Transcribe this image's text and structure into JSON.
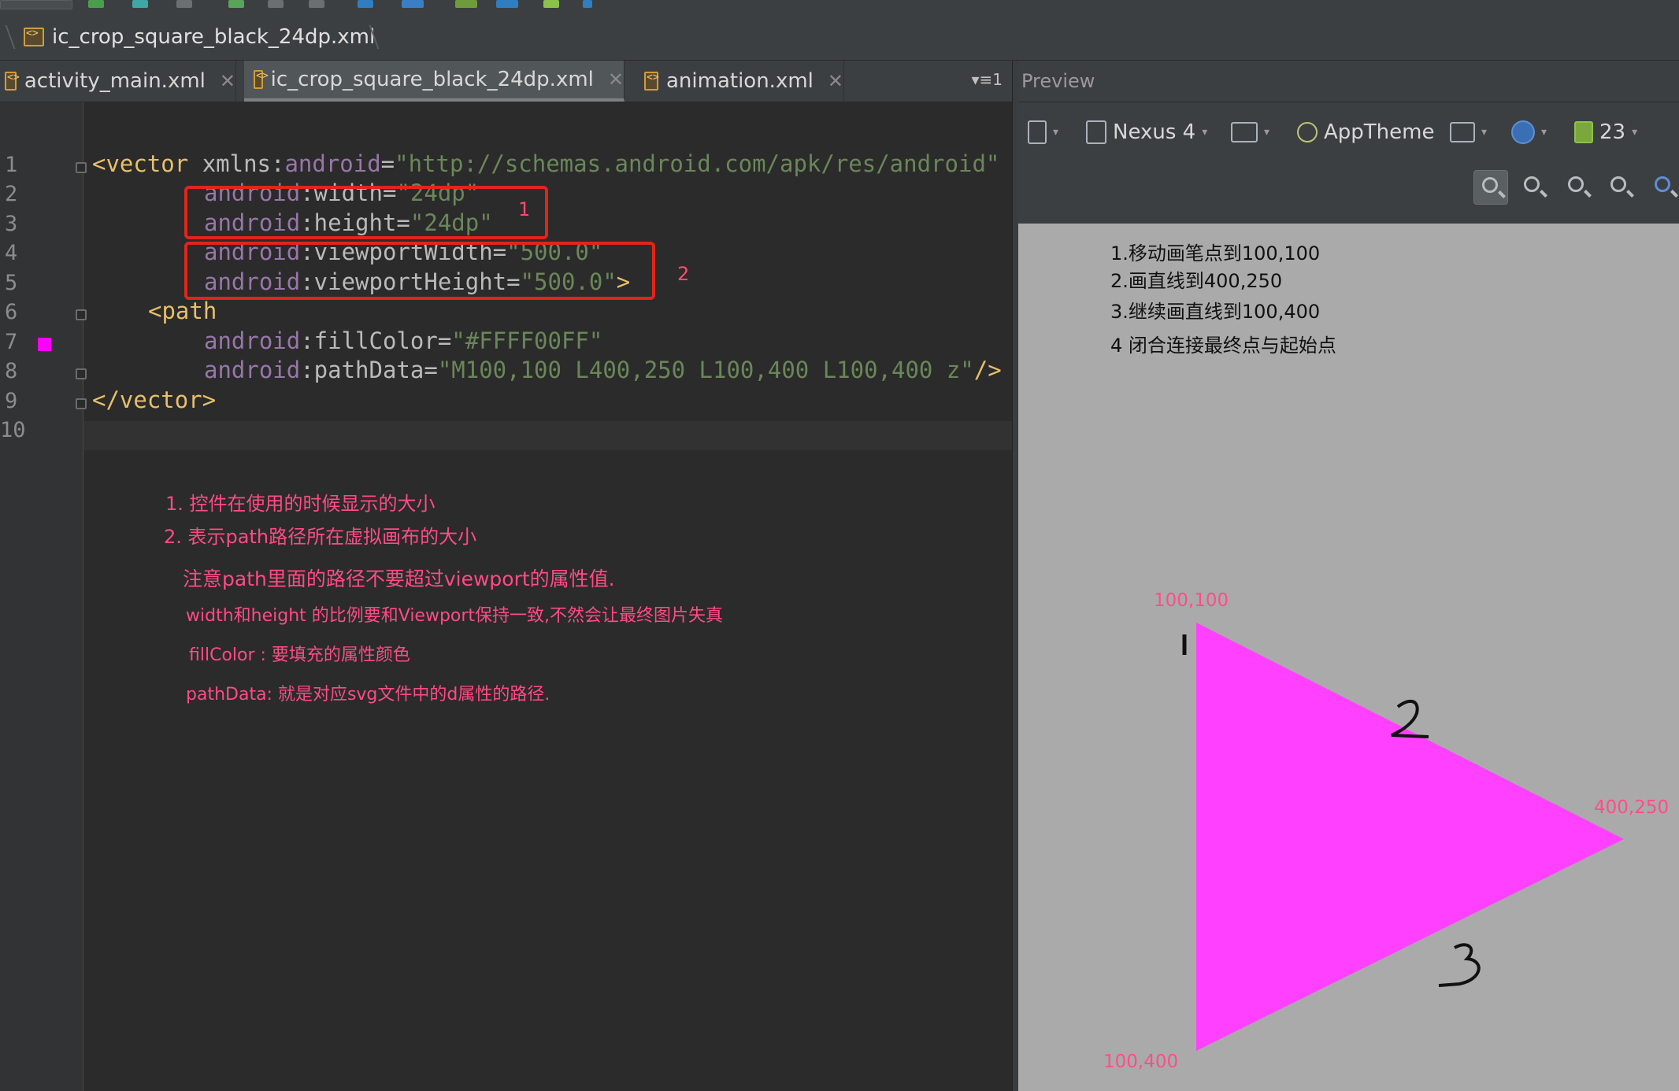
{
  "breadcrumb": {
    "file": "ic_crop_square_black_24dp.xml"
  },
  "tabs": [
    {
      "label": "activity_main.xml",
      "active": false
    },
    {
      "label": "ic_crop_square_black_24dp.xml",
      "active": true
    },
    {
      "label": "animation.xml",
      "active": false
    }
  ],
  "tab_overflow": "▾≡1",
  "editor": {
    "line_numbers": [
      "1",
      "2",
      "3",
      "4",
      "5",
      "6",
      "7",
      "8",
      "9",
      "10"
    ],
    "code": {
      "l1": {
        "open": "<vector ",
        "attr": "xmlns:",
        "ns": "android",
        "eq": "=",
        "val": "\"http://schemas.android.com/apk/res/android\""
      },
      "l2": {
        "ns": "android",
        "attr": ":width=",
        "val": "\"24dp\""
      },
      "l3": {
        "ns": "android",
        "attr": ":height=",
        "val": "\"24dp\""
      },
      "l4": {
        "ns": "android",
        "attr": ":viewportWidth=",
        "val": "\"500.0\""
      },
      "l5": {
        "ns": "android",
        "attr": ":viewportHeight=",
        "val": "\"500.0\"",
        "close": ">"
      },
      "l6": {
        "open": "<path"
      },
      "l7": {
        "ns": "android",
        "attr": ":fillColor=",
        "val": "\"#FFFF00FF\""
      },
      "l8": {
        "ns": "android",
        "attr": ":pathData=",
        "val": "\"M100,100 L400,250 L100,400 L100,400 z\"",
        "close": "/>"
      },
      "l9": {
        "close": "</vector>"
      }
    },
    "fill_color": "#ff00ff",
    "box_labels": {
      "one": "1",
      "two": "2"
    },
    "notes": [
      "1. 控件在使用的时候显示的大小",
      "2. 表示path路径所在虚拟画布的大小",
      "注意path里面的路径不要超过viewport的属性值.",
      "width和height 的比例要和Viewport保持一致,不然会让最终图片失真",
      "fillColor : 要填充的属性颜色",
      "pathData: 就是对应svg文件中的d属性的路径."
    ]
  },
  "preview": {
    "title": "Preview",
    "toolbar": {
      "device": "Nexus 4",
      "theme": "AppTheme",
      "api": "23"
    },
    "steps": [
      "1.移动画笔点到100,100",
      "2.画直线到400,250",
      "3.继续画直线到100,400",
      "4 闭合连接最终点与起始点"
    ],
    "coords": {
      "p1": "100,100",
      "p2": "400,250",
      "p3": "100,400"
    },
    "triangle_color": "#ff41ff",
    "handwritten": [
      "1",
      "2",
      "3"
    ]
  }
}
